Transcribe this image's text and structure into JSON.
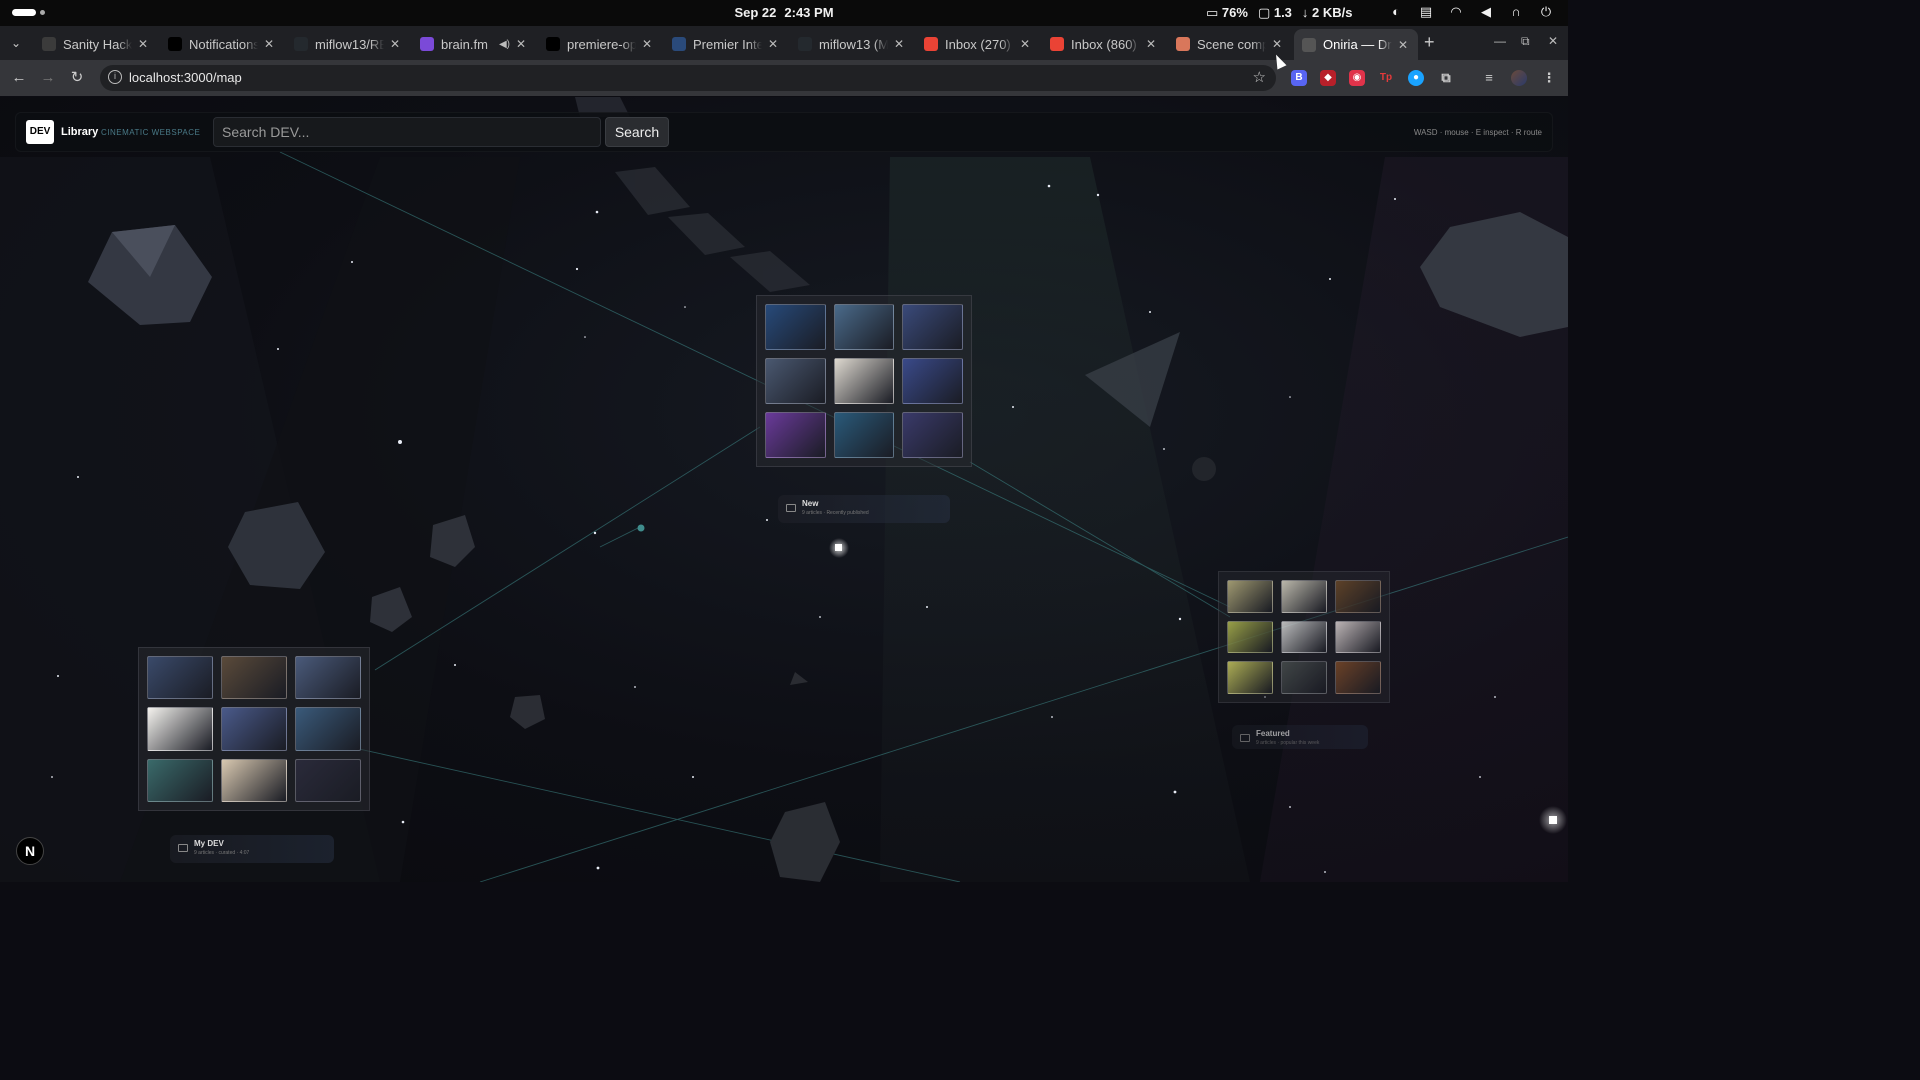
{
  "os_bar": {
    "date": "Sep 22",
    "time": "2:43 PM",
    "battery": "76%",
    "load": "1.3",
    "net": "2 KB/s"
  },
  "tabs": [
    {
      "title": "Sanity Hack",
      "favicon": "sanity-icon",
      "color": "#3b3b3b"
    },
    {
      "title": "Notifications",
      "favicon": "dev-icon",
      "color": "#000000"
    },
    {
      "title": "miflow13/RE",
      "favicon": "github-icon",
      "color": "#24292e"
    },
    {
      "title": "brain.fm",
      "favicon": "brainfm-icon",
      "color": "#7b4ad8",
      "audio": true
    },
    {
      "title": "premiere-op",
      "favicon": "vercel-icon",
      "color": "#000000"
    },
    {
      "title": "Premier Inte",
      "favicon": "p-icon",
      "color": "#2a4a7a"
    },
    {
      "title": "miflow13 (M",
      "favicon": "github-icon",
      "color": "#24292e"
    },
    {
      "title": "Inbox (270)",
      "favicon": "gmail-icon",
      "color": "#ea4335"
    },
    {
      "title": "Inbox (860)",
      "favicon": "gmail-icon",
      "color": "#ea4335"
    },
    {
      "title": "Scene comp",
      "favicon": "claude-icon",
      "color": "#d9775b"
    },
    {
      "title": "Oniria — Dr",
      "favicon": "globe-icon",
      "color": "#555555",
      "active": true
    }
  ],
  "toolbar": {
    "url": "localhost:3000/map"
  },
  "app": {
    "logo": "DEV",
    "brand": "Library",
    "tagline": "CINEMATIC WEBSPACE",
    "search_placeholder": "Search DEV...",
    "search_button": "Search",
    "hints": "WASD · mouse · E inspect · R route",
    "n_badge": "N"
  },
  "boards": [
    {
      "name": "New",
      "subtitle": "9 articles · Recently published",
      "thumbs": [
        "#274a7a",
        "#4a6a8a",
        "#3a4a7a",
        "#4a5870",
        "#ddd8cf",
        "#3a4a8a",
        "#6a3a9a",
        "#2a5a7a",
        "#3a3a6a"
      ]
    },
    {
      "name": "Featured",
      "subtitle": "9 articles · popular this week",
      "thumbs": [
        "#b8b080",
        "#d8d4c4",
        "#6a4a2a",
        "#b0b850",
        "#d8d8d8",
        "#d8cfcf",
        "#c8c860",
        "#4a5050",
        "#7a4a2a"
      ]
    },
    {
      "name": "My DEV",
      "subtitle": "9 articles · curated · 4:07",
      "thumbs": [
        "#3a4a6a",
        "#5a4a3a",
        "#4a5a7a",
        "#f4f2ee",
        "#4a5a8a",
        "#3a5a7a",
        "#3a6a6a",
        "#d8c8b0",
        "#2a2a3a"
      ]
    }
  ]
}
